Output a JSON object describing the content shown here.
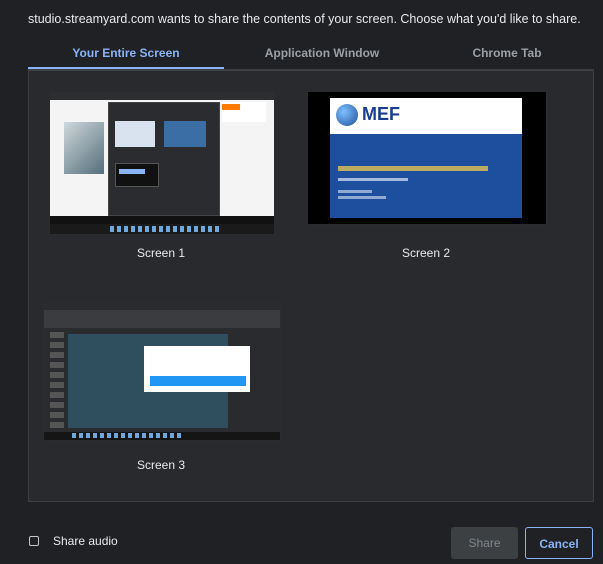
{
  "dialog": {
    "header": "studio.streamyard.com wants to share the contents of your screen. Choose what you'd like to share."
  },
  "tabs": [
    {
      "label": "Your Entire Screen",
      "active": true
    },
    {
      "label": "Application Window",
      "active": false
    },
    {
      "label": "Chrome Tab",
      "active": false
    }
  ],
  "screens": [
    {
      "label": "Screen 1",
      "icon": "desktop-screenshot"
    },
    {
      "label": "Screen 2",
      "icon": "presentation-slide"
    },
    {
      "label": "Screen 3",
      "icon": "desktop-screenshot"
    }
  ],
  "screen2_slide": {
    "logo_text": "MEF"
  },
  "footer": {
    "share_audio_label": "Share audio",
    "share_audio_checked": false,
    "share_button_label": "Share",
    "cancel_button_label": "Cancel"
  },
  "colors": {
    "background": "#202124",
    "panel": "#292a2d",
    "accent": "#8ab4f8",
    "text": "#e8eaed",
    "muted_text": "#9aa0a6"
  }
}
